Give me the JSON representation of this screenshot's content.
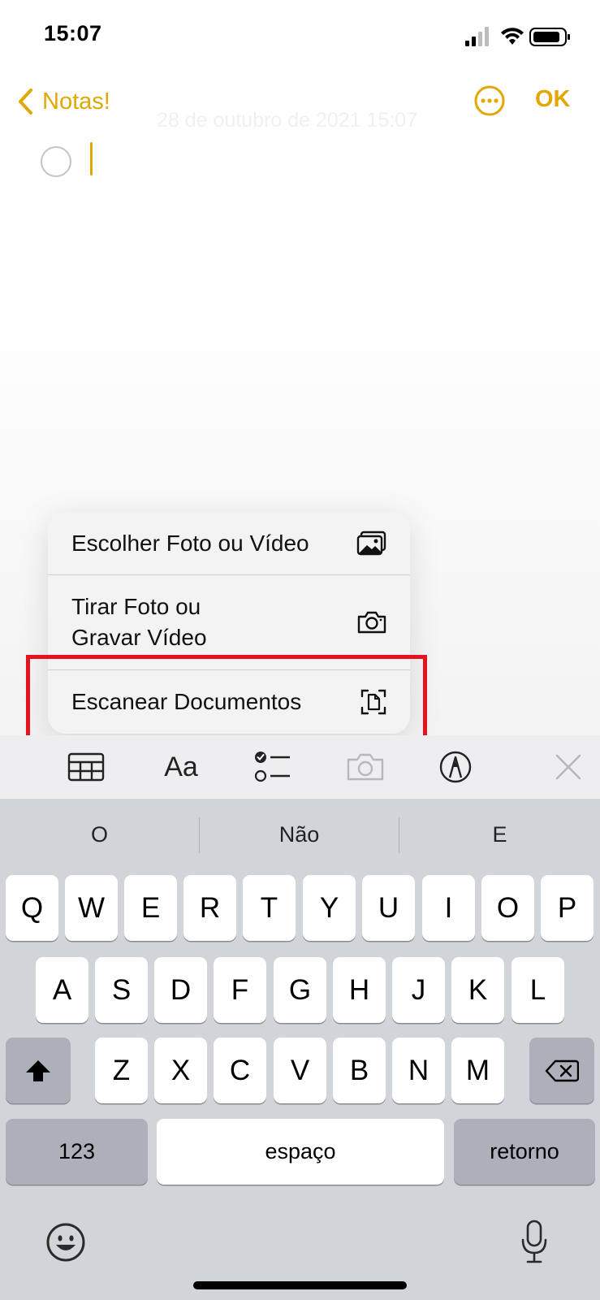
{
  "status": {
    "time": "15:07"
  },
  "nav": {
    "back_label": "Notas!",
    "done_label": "OK",
    "date_text": "28 de outubro de 2021 15:07"
  },
  "menu": {
    "items": [
      {
        "label": "Escolher Foto ou Vídeo",
        "icon": "photo-library-icon"
      },
      {
        "label": "Tirar Foto ou\nGravar Vídeo",
        "icon": "camera-icon"
      },
      {
        "label": "Escanear Documentos",
        "icon": "doc-scan-icon",
        "highlighted": true
      }
    ]
  },
  "toolbar": {
    "format_label": "Aa",
    "icons": [
      "table-icon",
      "format-text-icon",
      "checklist-icon",
      "camera-icon",
      "markup-icon",
      "close-icon"
    ]
  },
  "keyboard": {
    "suggestions": [
      "O",
      "Não",
      "E"
    ],
    "row1": [
      "Q",
      "W",
      "E",
      "R",
      "T",
      "Y",
      "U",
      "I",
      "O",
      "P"
    ],
    "row2": [
      "A",
      "S",
      "D",
      "F",
      "G",
      "H",
      "J",
      "K",
      "L"
    ],
    "row3": [
      "Z",
      "X",
      "C",
      "V",
      "B",
      "N",
      "M"
    ],
    "numbers_label": "123",
    "space_label": "espaço",
    "return_label": "retorno"
  },
  "colors": {
    "accent": "#e0a800",
    "highlight_box": "#e3141f",
    "keyboard_bg": "#d1d4d9"
  }
}
